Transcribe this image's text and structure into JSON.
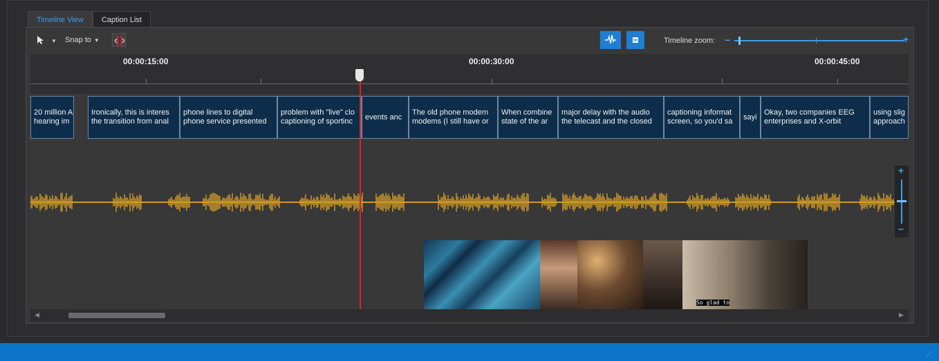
{
  "tabs": [
    {
      "label": "Timeline View",
      "active": true
    },
    {
      "label": "Caption List",
      "active": false
    }
  ],
  "toolbar": {
    "snap_label": "Snap to",
    "zoom_label": "Timeline zoom:",
    "zoom_minus": "−",
    "zoom_plus": "+",
    "icons": [
      "cursor-icon",
      "snap-icon",
      "waveform-icon",
      "captions-icon"
    ]
  },
  "ruler": {
    "timecodes": [
      "00:00:15:00",
      "00:00:30:00",
      "00:00:45:00"
    ]
  },
  "captions": [
    {
      "line1": "20 million A",
      "line2": "hearing im"
    },
    {
      "line1": "Ironically, this is interes",
      "line2": "the transition from anal"
    },
    {
      "line1": "phone lines to digital",
      "line2": "phone service presented"
    },
    {
      "line1": "problem with \"live\" clo",
      "line2": "captioning of sportinc"
    },
    {
      "line1": "events anc",
      "line2": ""
    },
    {
      "line1": "The old phone modem",
      "line2": "modems (I still have or"
    },
    {
      "line1": "When combine",
      "line2": "state of the ar"
    },
    {
      "line1": "major delay with the audio",
      "line2": "the telecast and the closed"
    },
    {
      "line1": "captioning informat",
      "line2": "screen, so you'd sa"
    },
    {
      "line1": "sayi",
      "line2": ""
    },
    {
      "line1": "Okay, two companies EEG",
      "line2": "enterprises and X-orbit"
    },
    {
      "line1": "using slig",
      "line2": "approach"
    }
  ],
  "vertical_zoom": {
    "plus": "+",
    "minus": "−"
  },
  "video_thumbnail_caption": "So glad to",
  "colors": {
    "accent": "#3b9ee8",
    "caption_bg": "#0e2d4a",
    "waveform": "#e0a526",
    "playhead": "#d8252c",
    "status_bar": "#0b74c8"
  }
}
